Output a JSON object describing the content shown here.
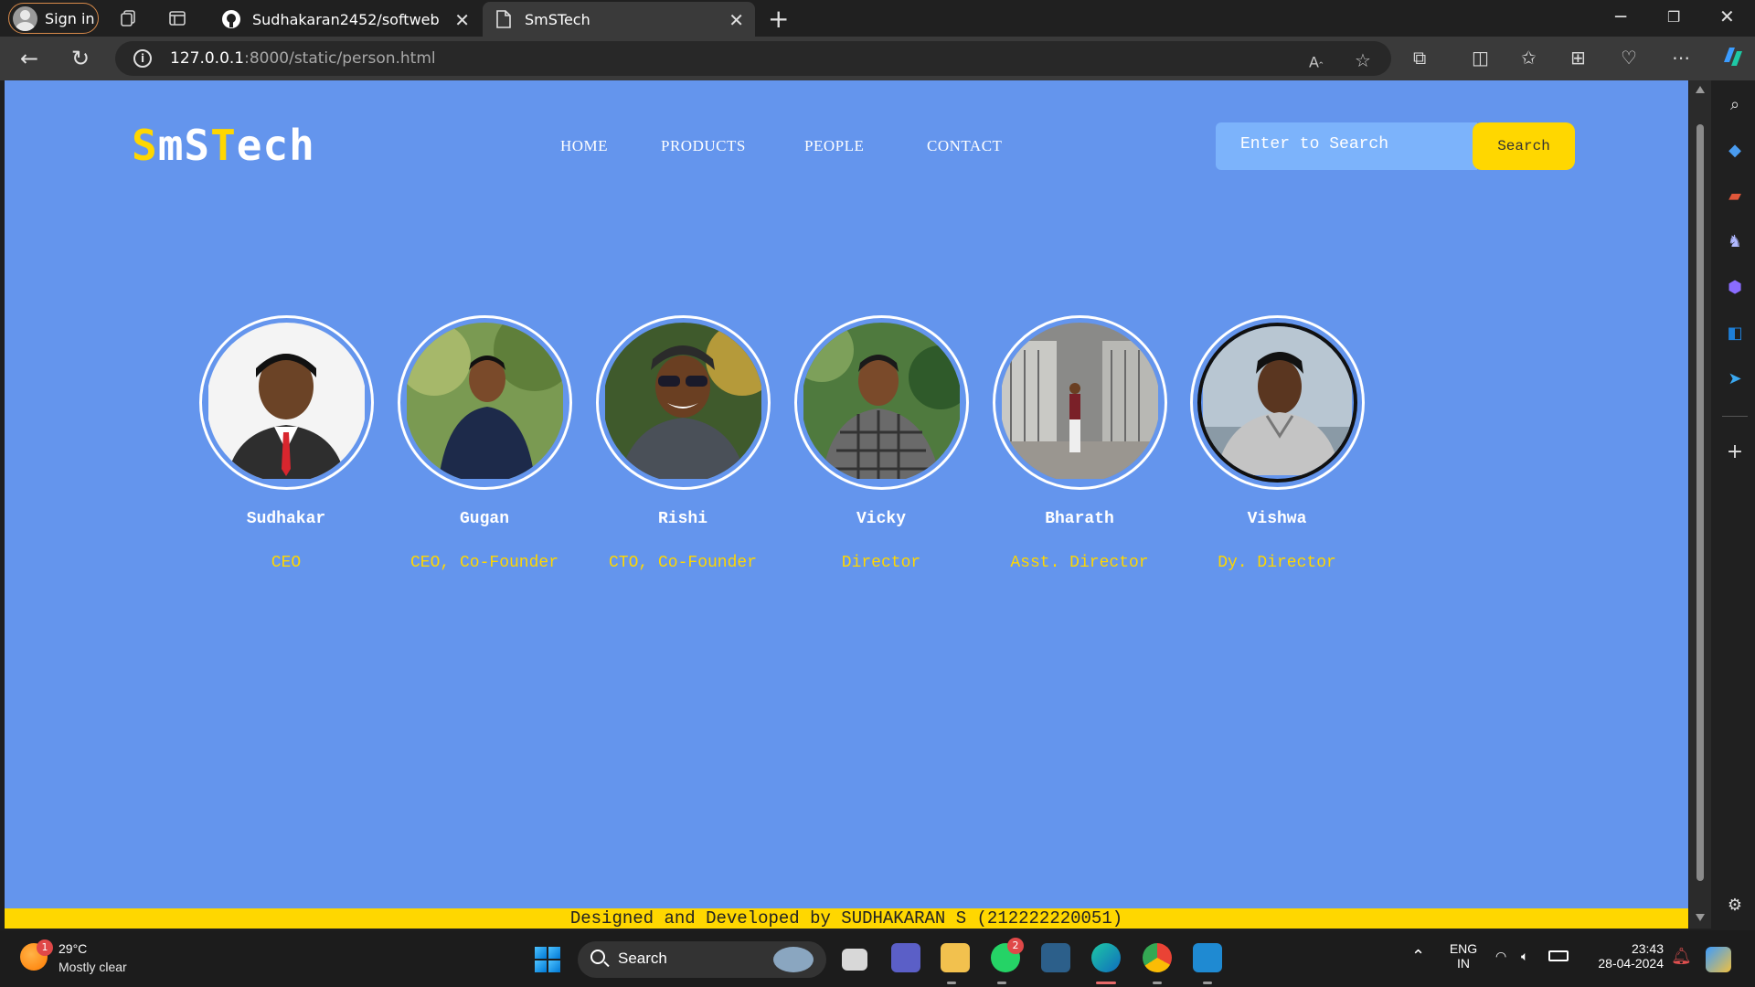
{
  "browser": {
    "signin_label": "Sign in",
    "tabs": [
      {
        "title": "Sudhakaran2452/softweb",
        "icon": "github-icon"
      },
      {
        "title": "SmSTech",
        "icon": "page-icon"
      }
    ],
    "url_host": "127.0.0.1",
    "url_rest": ":8000/static/person.html"
  },
  "site": {
    "logo_parts": [
      "S",
      "mS",
      "T",
      "ech"
    ],
    "nav": [
      "HOME",
      "PRODUCTS",
      "PEOPLE",
      "CONTACT"
    ],
    "search_placeholder": "Enter to Search",
    "search_button": "Search",
    "footer": "Designed and Developed by SUDHAKARAN S (212222220051)",
    "colors": {
      "background": "#6495ED",
      "accent": "#FFD700",
      "search_field": "#7cb3fb"
    }
  },
  "people": [
    {
      "name": "Sudhakar",
      "role": "CEO"
    },
    {
      "name": "Gugan",
      "role": "CEO, Co-Founder"
    },
    {
      "name": "Rishi",
      "role": "CTO, Co-Founder"
    },
    {
      "name": "Vicky",
      "role": "Director"
    },
    {
      "name": "Bharath",
      "role": "Asst. Director"
    },
    {
      "name": "Vishwa",
      "role": "Dy. Director"
    }
  ],
  "taskbar": {
    "weather_badge": "1",
    "temperature": "29°C",
    "condition": "Mostly clear",
    "search_label": "Search",
    "whatsapp_badge": "2",
    "lang_top": "ENG",
    "lang_bottom": "IN",
    "time": "23:43",
    "date": "28-04-2024"
  }
}
